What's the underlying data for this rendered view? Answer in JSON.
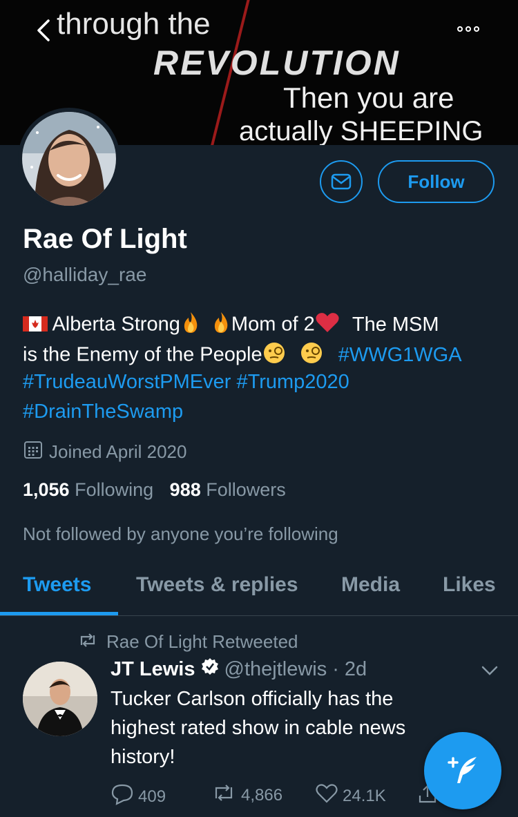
{
  "banner": {
    "line1": "through the",
    "line2": "REVOLUTION",
    "line3": "Then you are",
    "line4": "actually SHEEPING"
  },
  "actions": {
    "follow_label": "Follow"
  },
  "profile": {
    "name": "Rae Of Light",
    "handle": "@halliday_rae",
    "bio": {
      "part1": "Alberta Strong",
      "part2": "Mom of 2",
      "part3": "The MSM",
      "line2_text": "is the Enemy of the People",
      "tag1": "#WWG1WGA",
      "tag2": "#TrudeauWorstPMEver",
      "tag3": "#Trump2020",
      "tag4": "#DrainTheSwamp"
    },
    "joined": "Joined April 2020",
    "following_count": "1,056",
    "following_label": "Following",
    "followers_count": "988",
    "followers_label": "Followers",
    "not_followed": "Not followed by anyone you’re following"
  },
  "tabs": [
    {
      "label": "Tweets"
    },
    {
      "label": "Tweets & replies"
    },
    {
      "label": "Media"
    },
    {
      "label": "Likes"
    }
  ],
  "tweet": {
    "retweeted_by": "Rae Of Light Retweeted",
    "author_name": "JT Lewis",
    "author_handle": "@thejtlewis",
    "separator": "·",
    "time": "2d",
    "text_line1": "Tucker Carlson officially has the",
    "text_line2": "highest rated show in cable news",
    "text_line3": "history!",
    "replies": "409",
    "retweets": "4,866",
    "likes": "24.1K"
  },
  "colors": {
    "background": "#15202b",
    "accent": "#1d9bf0",
    "secondary_text": "#8899a6",
    "divider": "#38444d"
  }
}
